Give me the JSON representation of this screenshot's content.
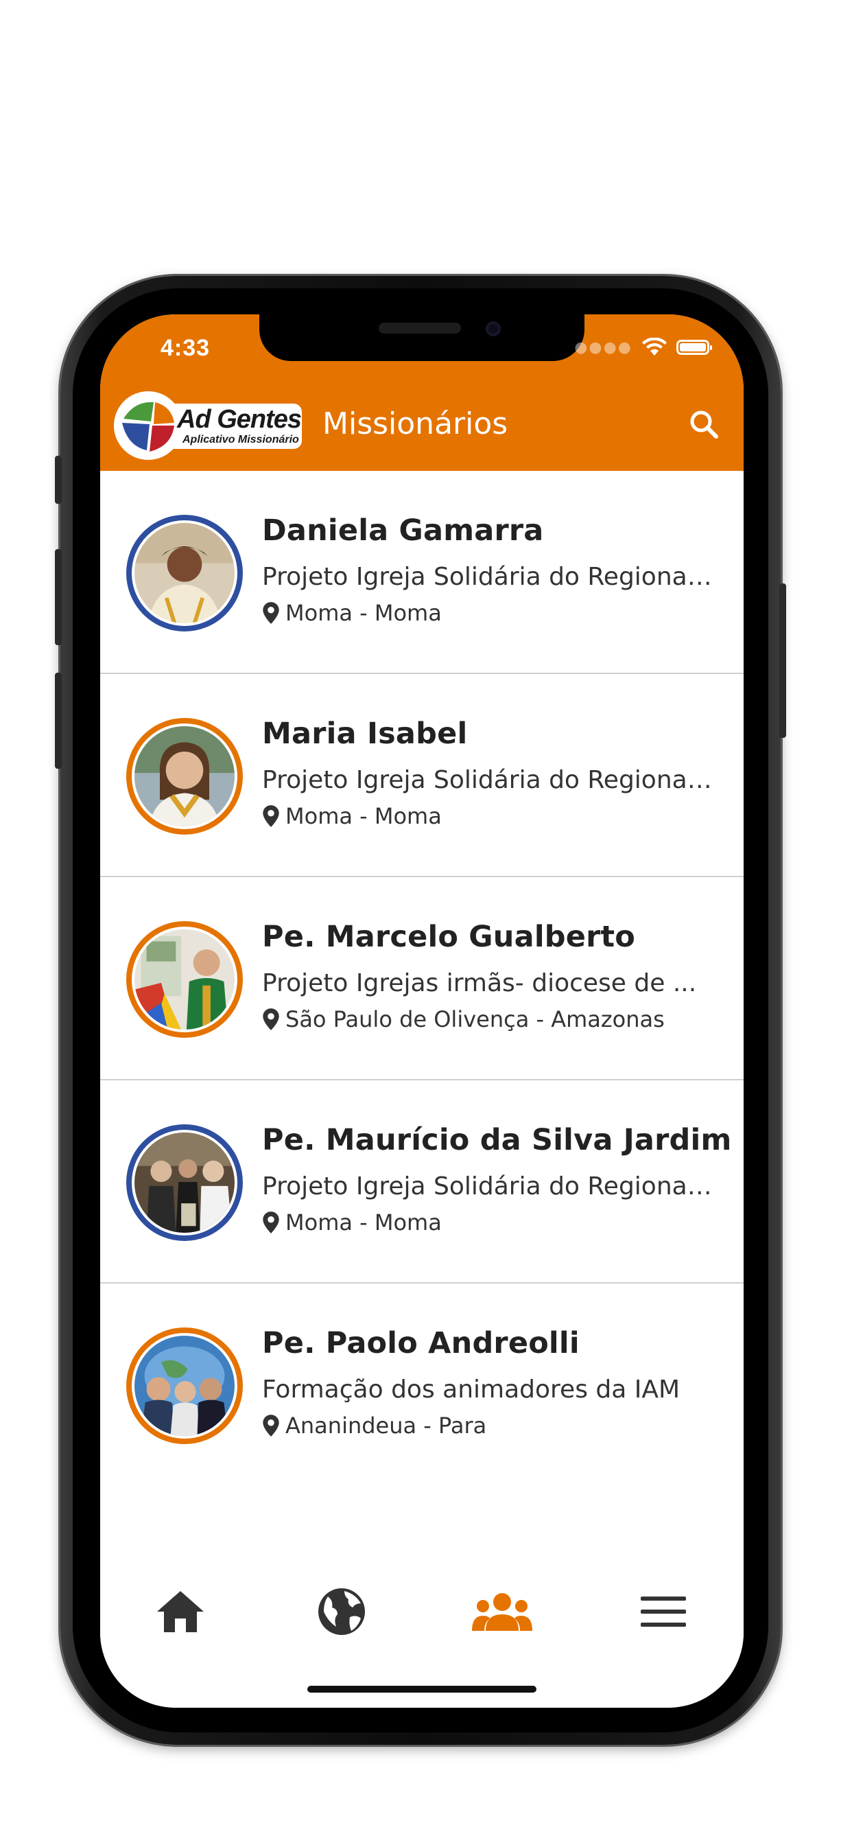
{
  "status_bar": {
    "time": "4:33"
  },
  "header": {
    "logo_title": "Ad Gentes",
    "logo_subtitle": "Aplicativo Missionário",
    "title": "Missionários",
    "search_icon": "search-icon",
    "accent_color": "#e57300"
  },
  "missionaries": [
    {
      "name": "Daniela Gamarra",
      "project": "Projeto Igreja Solidária do Regional ...",
      "location": "Moma - Moma",
      "ring": "blue"
    },
    {
      "name": "Maria Isabel",
      "project": "Projeto Igreja Solidária do Regional ...",
      "location": "Moma - Moma",
      "ring": "orange"
    },
    {
      "name": "Pe. Marcelo Gualberto",
      "project": "Projeto Igrejas irmãs- diocese de ...",
      "location": "São Paulo de Olivença - Amazonas",
      "ring": "orange"
    },
    {
      "name": "Pe. Maurício da Silva Jardim",
      "project": "Projeto Igreja Solidária do Regional ...",
      "location": "Moma - Moma",
      "ring": "blue"
    },
    {
      "name": "Pe. Paolo Andreolli",
      "project": "Formação dos animadores da IAM",
      "location": "Ananindeua - Para",
      "ring": "orange"
    }
  ],
  "tabbar": {
    "items": [
      {
        "icon": "home-icon",
        "active": false
      },
      {
        "icon": "globe-icon",
        "active": false
      },
      {
        "icon": "people-icon",
        "active": true
      },
      {
        "icon": "menu-icon",
        "active": false
      }
    ],
    "active_color": "#e57300",
    "inactive_color": "#333333"
  }
}
